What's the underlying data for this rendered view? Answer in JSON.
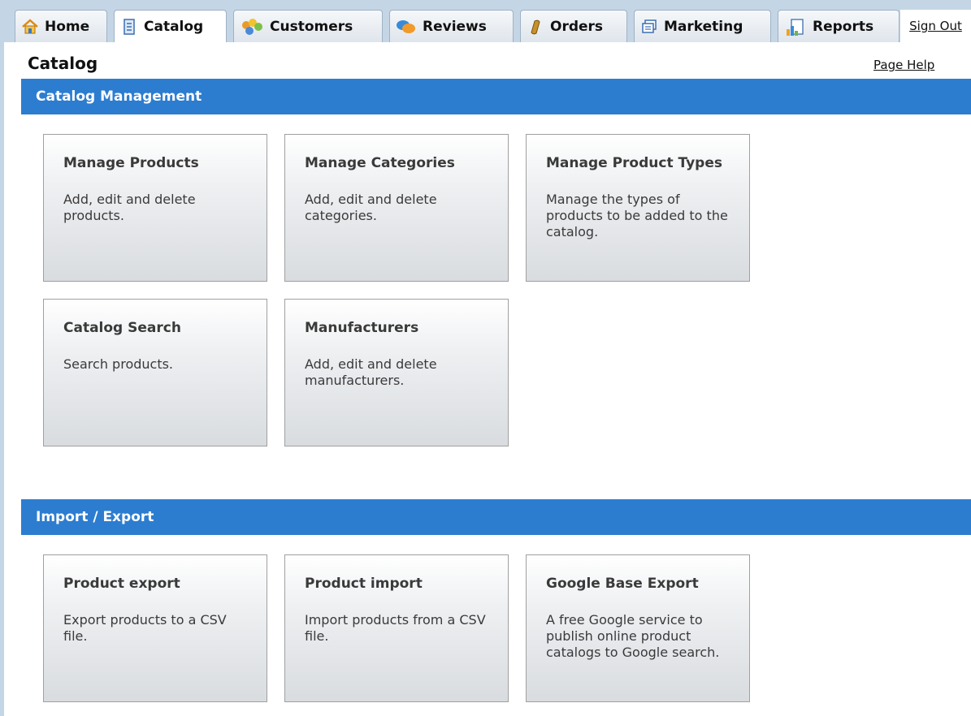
{
  "tabs": [
    {
      "label": "Home",
      "icon": "home-icon"
    },
    {
      "label": "Catalog",
      "icon": "catalog-icon"
    },
    {
      "label": "Customers",
      "icon": "customers-icon"
    },
    {
      "label": "Reviews",
      "icon": "reviews-icon"
    },
    {
      "label": "Orders",
      "icon": "orders-icon"
    },
    {
      "label": "Marketing",
      "icon": "marketing-icon"
    },
    {
      "label": "Reports",
      "icon": "reports-icon"
    }
  ],
  "active_tab": "Catalog",
  "sign_out_label": "Sign Out",
  "page": {
    "title": "Catalog",
    "help_label": "Page Help"
  },
  "sections": [
    {
      "title": "Catalog Management",
      "cards": [
        {
          "title": "Manage Products",
          "desc": "Add, edit and delete products."
        },
        {
          "title": "Manage Categories",
          "desc": "Add, edit and delete categories."
        },
        {
          "title": "Manage Product Types",
          "desc": "Manage the types of products to be added to the catalog."
        },
        {
          "title": "Catalog Search",
          "desc": "Search products."
        },
        {
          "title": "Manufacturers",
          "desc": "Add, edit and delete manufacturers."
        }
      ]
    },
    {
      "title": "Import / Export",
      "cards": [
        {
          "title": "Product export",
          "desc": "Export products to a CSV file."
        },
        {
          "title": "Product import",
          "desc": "Import products from a CSV file."
        },
        {
          "title": "Google Base Export",
          "desc": "A free Google service to publish online product catalogs to Google search."
        }
      ]
    }
  ],
  "colors": {
    "section_bar": "#2c7dd0",
    "tabbar_bg": "#c4d6e6"
  }
}
